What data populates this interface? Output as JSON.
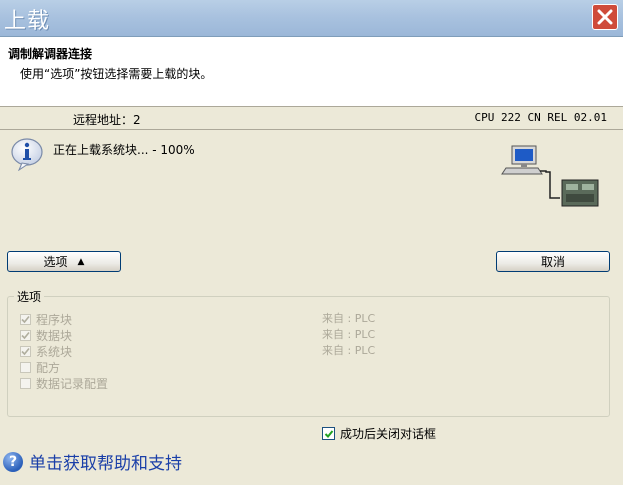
{
  "window": {
    "title": "上载"
  },
  "header": {
    "title": "调制解调器连接",
    "subtitle": "使用“选项”按钮选择需要上载的块。"
  },
  "connection": {
    "remote_address": "远程地址：2",
    "cpu_version": "CPU 222 CN REL 02.01"
  },
  "status": {
    "text": "正在上载系统块... - 100%",
    "icon": "info-icon"
  },
  "buttons": {
    "options_label": "选项",
    "options_arrow": "▲",
    "cancel_label": "取消"
  },
  "options": {
    "legend": "选项",
    "items": [
      {
        "label": "程序块",
        "checked": true,
        "source": "来自 : PLC"
      },
      {
        "label": "数据块",
        "checked": true,
        "source": "来自 : PLC"
      },
      {
        "label": "系统块",
        "checked": true,
        "source": "来自 : PLC"
      },
      {
        "label": "配方",
        "checked": false,
        "source": ""
      },
      {
        "label": "数据记录配置",
        "checked": false,
        "source": ""
      }
    ]
  },
  "close_on_success": {
    "label": "成功后关闭对话框",
    "checked": true
  },
  "help": {
    "label": "单击获取帮助和支持"
  },
  "colors": {
    "title_bar": "#a9c2df",
    "dialog_bg": "#ece9d8",
    "close_red": "#cf4b3a",
    "link_blue": "#1a3fa8"
  }
}
